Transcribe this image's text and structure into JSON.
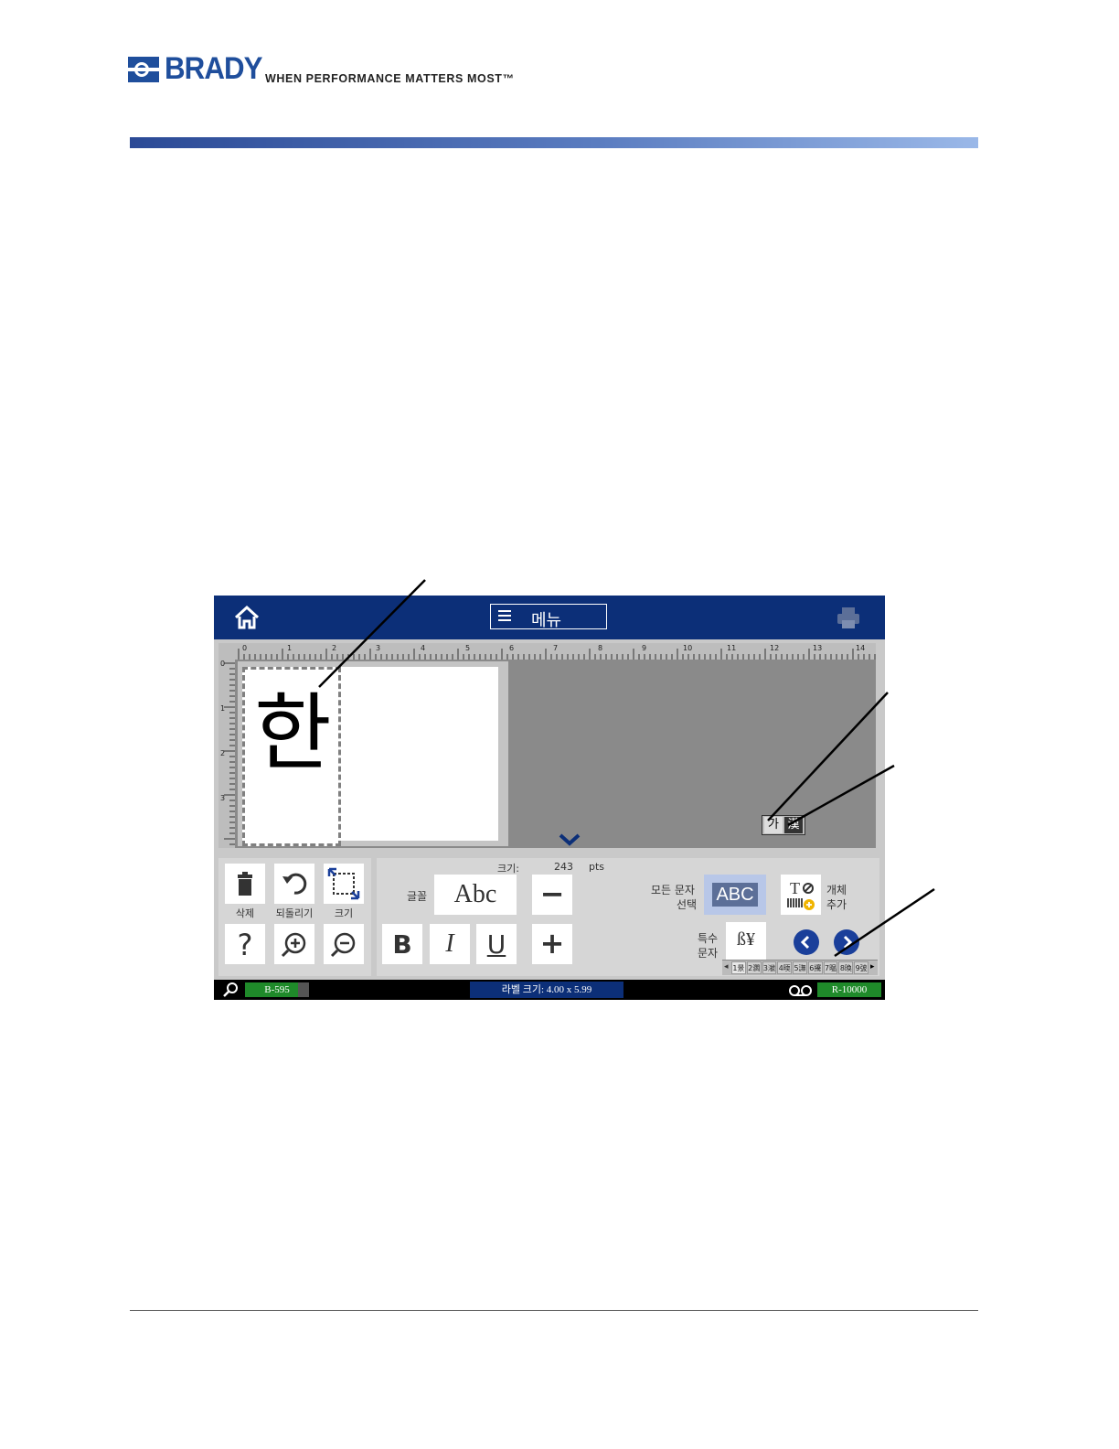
{
  "document": {
    "brand": "BRADY",
    "tagline": "WHEN PERFORMANCE MATTERS MOST™"
  },
  "screen": {
    "topbar": {
      "menu_label": "메뉴",
      "home_icon": "home-icon",
      "print_icon": "printer-icon"
    },
    "canvas": {
      "ruler_top_numbers": [
        "0",
        "1",
        "2",
        "3",
        "4",
        "5",
        "6",
        "7",
        "8",
        "9",
        "10",
        "11",
        "12",
        "13",
        "14"
      ],
      "ruler_left_numbers": [
        "0",
        "1",
        "2",
        "3"
      ],
      "text_object": "한",
      "input_mode": {
        "left": "가",
        "right": "漢"
      }
    },
    "toolbar": {
      "delete_label": "삭제",
      "undo_label": "되돌리기",
      "size_label": "크기",
      "help_symbol": "?",
      "size_info_label": "크기:",
      "size_value": "243",
      "size_unit": "pts",
      "font_label": "글꼴",
      "font_sample": "Abc",
      "minus_symbol": "−",
      "plus_symbol": "+",
      "bold": "B",
      "italic": "I",
      "underline": "U",
      "all_caps_label_1": "모든 문자",
      "all_caps_label_2": "선택",
      "all_caps_sample": "ABC",
      "add_object_label_1": "개체",
      "add_object_label_2": "추가",
      "special_char_label_1": "특수",
      "special_char_label_2": "문자",
      "special_char_sample": "ß¥",
      "tabs": [
        "1景",
        "2㶄",
        "3㶁",
        "4㬉",
        "5㶃",
        "6㩷",
        "7㬈",
        "8㬇",
        "9㢰"
      ]
    },
    "status": {
      "printer_model": "B-595",
      "label_size": "라벨 크기: 4.00 x 5.99",
      "ribbon_model": "R-10000"
    }
  },
  "colors": {
    "brand_blue": "#1f4e9c",
    "topbar": "#0c2f78",
    "status_green": "#1f8a2a",
    "nav_blue": "#1a3f9a"
  }
}
